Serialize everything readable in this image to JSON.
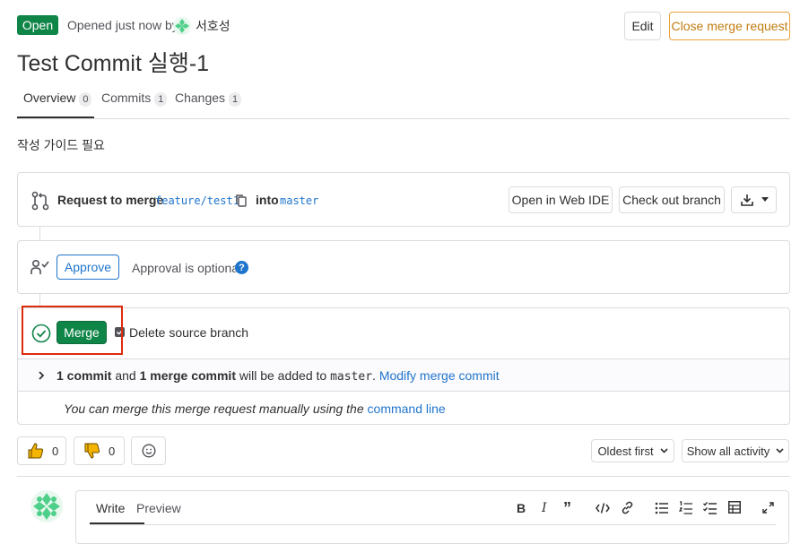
{
  "header": {
    "status_badge": "Open",
    "opened_text": "Opened just now by",
    "author_name": "서호성",
    "edit_label": "Edit",
    "close_label": "Close merge request"
  },
  "title": "Test Commit 실행-1",
  "tabs": [
    {
      "label": "Overview",
      "count": "0"
    },
    {
      "label": "Commits",
      "count": "1"
    },
    {
      "label": "Changes",
      "count": "1"
    }
  ],
  "description": "작성 가이드 필요",
  "merge_request": {
    "request_label": "Request to merge",
    "source_branch": "feature/test1",
    "into_label": "into",
    "target_branch": "master",
    "open_web_ide_label": "Open in Web IDE",
    "check_out_label": "Check out branch"
  },
  "approval": {
    "approve_label": "Approve",
    "optional_text": "Approval is optional"
  },
  "merge": {
    "merge_label": "Merge",
    "delete_source_label": "Delete source branch",
    "commit_count": "1 commit",
    "and_text": "and",
    "merge_commit_count": "1 merge commit",
    "added_text": "will be added to",
    "target_branch": "master",
    "period": ".",
    "modify_link": "Modify merge commit",
    "manual_text": "You can merge this merge request manually using the",
    "command_line_link": "command line"
  },
  "reactions": {
    "thumbs_up_count": "0",
    "thumbs_down_count": "0"
  },
  "activity": {
    "sort_label": "Oldest first",
    "filter_label": "Show all activity"
  },
  "comment_editor": {
    "write_tab": "Write",
    "preview_tab": "Preview"
  },
  "colors": {
    "green": "#108548",
    "blue": "#1f75cb",
    "orange": "#c17d10",
    "highlight_red": "#dd2b0e"
  }
}
